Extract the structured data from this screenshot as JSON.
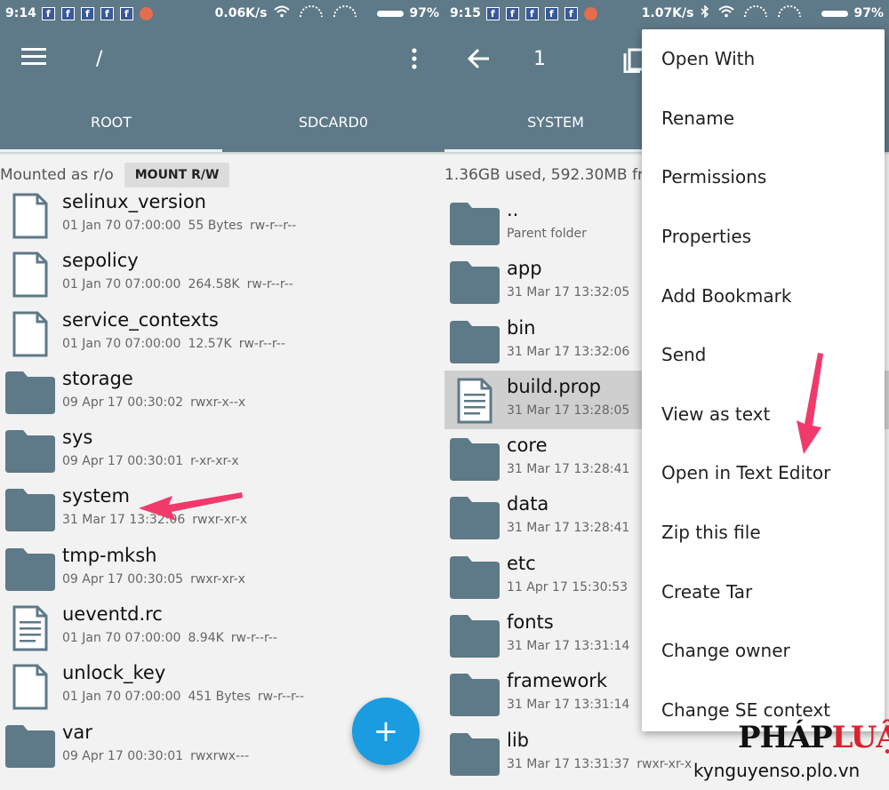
{
  "left": {
    "status": {
      "time": "9:14",
      "speed": "0.06K/s",
      "battery": "97%"
    },
    "appbar": {
      "path": "/"
    },
    "tabs": [
      "ROOT",
      "SDCARD0"
    ],
    "info": {
      "mounted": "Mounted as r/o",
      "mount_button": "MOUNT R/W"
    },
    "files": [
      {
        "name": "selinux_version",
        "date": "01 Jan 70 07:00:00",
        "size": "55 Bytes",
        "perm": "rw-r--r--",
        "kind": "file"
      },
      {
        "name": "sepolicy",
        "date": "01 Jan 70 07:00:00",
        "size": "264.58K",
        "perm": "rw-r--r--",
        "kind": "file"
      },
      {
        "name": "service_contexts",
        "date": "01 Jan 70 07:00:00",
        "size": "12.57K",
        "perm": "rw-r--r--",
        "kind": "file"
      },
      {
        "name": "storage",
        "date": "09 Apr 17 00:30:02",
        "size": "",
        "perm": "rwxr-x--x",
        "kind": "folder"
      },
      {
        "name": "sys",
        "date": "09 Apr 17 00:30:01",
        "size": "",
        "perm": "r-xr-xr-x",
        "kind": "folder"
      },
      {
        "name": "system",
        "date": "31 Mar 17 13:32:06",
        "size": "",
        "perm": "rwxr-xr-x",
        "kind": "folder"
      },
      {
        "name": "tmp-mksh",
        "date": "09 Apr 17 00:30:05",
        "size": "",
        "perm": "rwxr-xr-x",
        "kind": "folder"
      },
      {
        "name": "ueventd.rc",
        "date": "01 Jan 70 07:00:00",
        "size": "8.94K",
        "perm": "rw-r--r--",
        "kind": "text"
      },
      {
        "name": "unlock_key",
        "date": "01 Jan 70 07:00:00",
        "size": "451 Bytes",
        "perm": "rw-r--r--",
        "kind": "file"
      },
      {
        "name": "var",
        "date": "09 Apr 17 00:30:01",
        "size": "",
        "perm": "rwxrwx---",
        "kind": "folder"
      }
    ],
    "fab_label": "+"
  },
  "right": {
    "status": {
      "time": "9:15",
      "speed": "1.07K/s",
      "battery": "97%"
    },
    "appbar": {
      "count": "1"
    },
    "tabs": [
      "SYSTEM"
    ],
    "info": {
      "usage": "1.36GB used, 592.30MB fr"
    },
    "files": [
      {
        "name": "..",
        "date": "Parent folder",
        "perm": "",
        "kind": "folder"
      },
      {
        "name": "app",
        "date": "31 Mar 17 13:32:05",
        "perm": "",
        "kind": "folder"
      },
      {
        "name": "bin",
        "date": "31 Mar 17 13:32:06",
        "perm": "",
        "kind": "folder"
      },
      {
        "name": "build.prop",
        "date": "31 Mar 17 13:28:05",
        "perm": "",
        "kind": "text"
      },
      {
        "name": "core",
        "date": "31 Mar 17 13:28:41",
        "perm": "",
        "kind": "folder"
      },
      {
        "name": "data",
        "date": "31 Mar 17 13:28:41",
        "perm": "",
        "kind": "folder"
      },
      {
        "name": "etc",
        "date": "11 Apr 17 15:30:53",
        "perm": "",
        "kind": "folder"
      },
      {
        "name": "fonts",
        "date": "31 Mar 17 13:31:14",
        "perm": "",
        "kind": "folder"
      },
      {
        "name": "framework",
        "date": "31 Mar 17 13:31:14",
        "perm": "",
        "kind": "folder"
      },
      {
        "name": "lib",
        "date": "31 Mar 17 13:31:37",
        "perm": "rwxr-xr-x",
        "kind": "folder"
      }
    ],
    "selected_index": 3
  },
  "context_menu": [
    "Open With",
    "Rename",
    "Permissions",
    "Properties",
    "Add Bookmark",
    "Send",
    "View as text",
    "Open in Text Editor",
    "Zip this file",
    "Create Tar",
    "Change owner",
    "Change SE context"
  ],
  "watermark": {
    "logo_a": "PHÁP",
    "logo_b": "LUẬT",
    "url": "kynguyenso.plo.vn"
  },
  "colors": {
    "appbar": "#5e7987",
    "folder": "#5e7987",
    "fab": "#1b9be0",
    "arrow": "#f03a6b",
    "selected": "#cfcfcf"
  }
}
